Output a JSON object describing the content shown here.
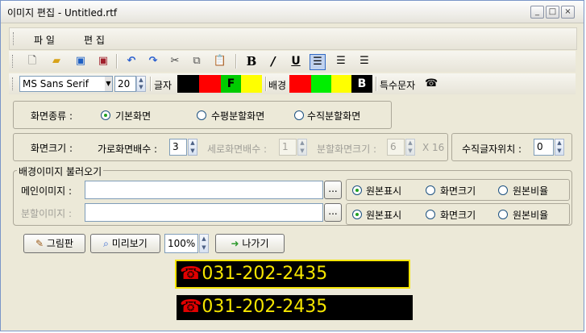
{
  "window": {
    "title": "이미지 편집 - Untitled.rtf",
    "min": "_",
    "max": "□",
    "close": "×"
  },
  "menu": {
    "file": "파 일",
    "edit": "편 집"
  },
  "toolbar": {
    "font_name": "MS Sans Serif",
    "font_size": "20",
    "text_color_label": "글자",
    "text_colors": [
      "#000000",
      "#ff0000",
      "#00cc00",
      "#ffff00"
    ],
    "text_color_selected_letter": "F",
    "bg_color_label": "배경",
    "bg_colors": [
      "#ff0000",
      "#00ee00",
      "#ffff00",
      "#000000"
    ],
    "bg_color_selected_letter": "B",
    "special_char_label": "특수문자",
    "special_char_icon": "☎"
  },
  "screen_type": {
    "label": "화면종류 :",
    "options": [
      "기본화면",
      "수평분할화면",
      "수직분할화면"
    ],
    "selected": 0
  },
  "screen_size": {
    "label": "화면크기 :",
    "horizontal_label": "가로화면배수 :",
    "horizontal_value": "3",
    "vertical_label": "세로화면배수 :",
    "vertical_value": "1",
    "split_label": "분할화면크기 :",
    "split_value": "6",
    "split_suffix": "X 16",
    "vertical_text_label": "수직글자위치 :",
    "vertical_text_value": "0"
  },
  "bg_image": {
    "group_label": "배경이미지 불러오기",
    "main_label": "메인이미지 :",
    "main_value": "",
    "split_label": "분할이미지 :",
    "split_value": "",
    "browse": "...",
    "display_options": [
      "원본표시",
      "화면크기",
      "원본비율"
    ],
    "main_selected": 0,
    "split_selected": 0
  },
  "actions": {
    "paint": "그림판",
    "preview": "미리보기",
    "zoom": "100%",
    "exit": "나가기"
  },
  "preview": {
    "text": "031-202-2435",
    "icon": "☎"
  }
}
